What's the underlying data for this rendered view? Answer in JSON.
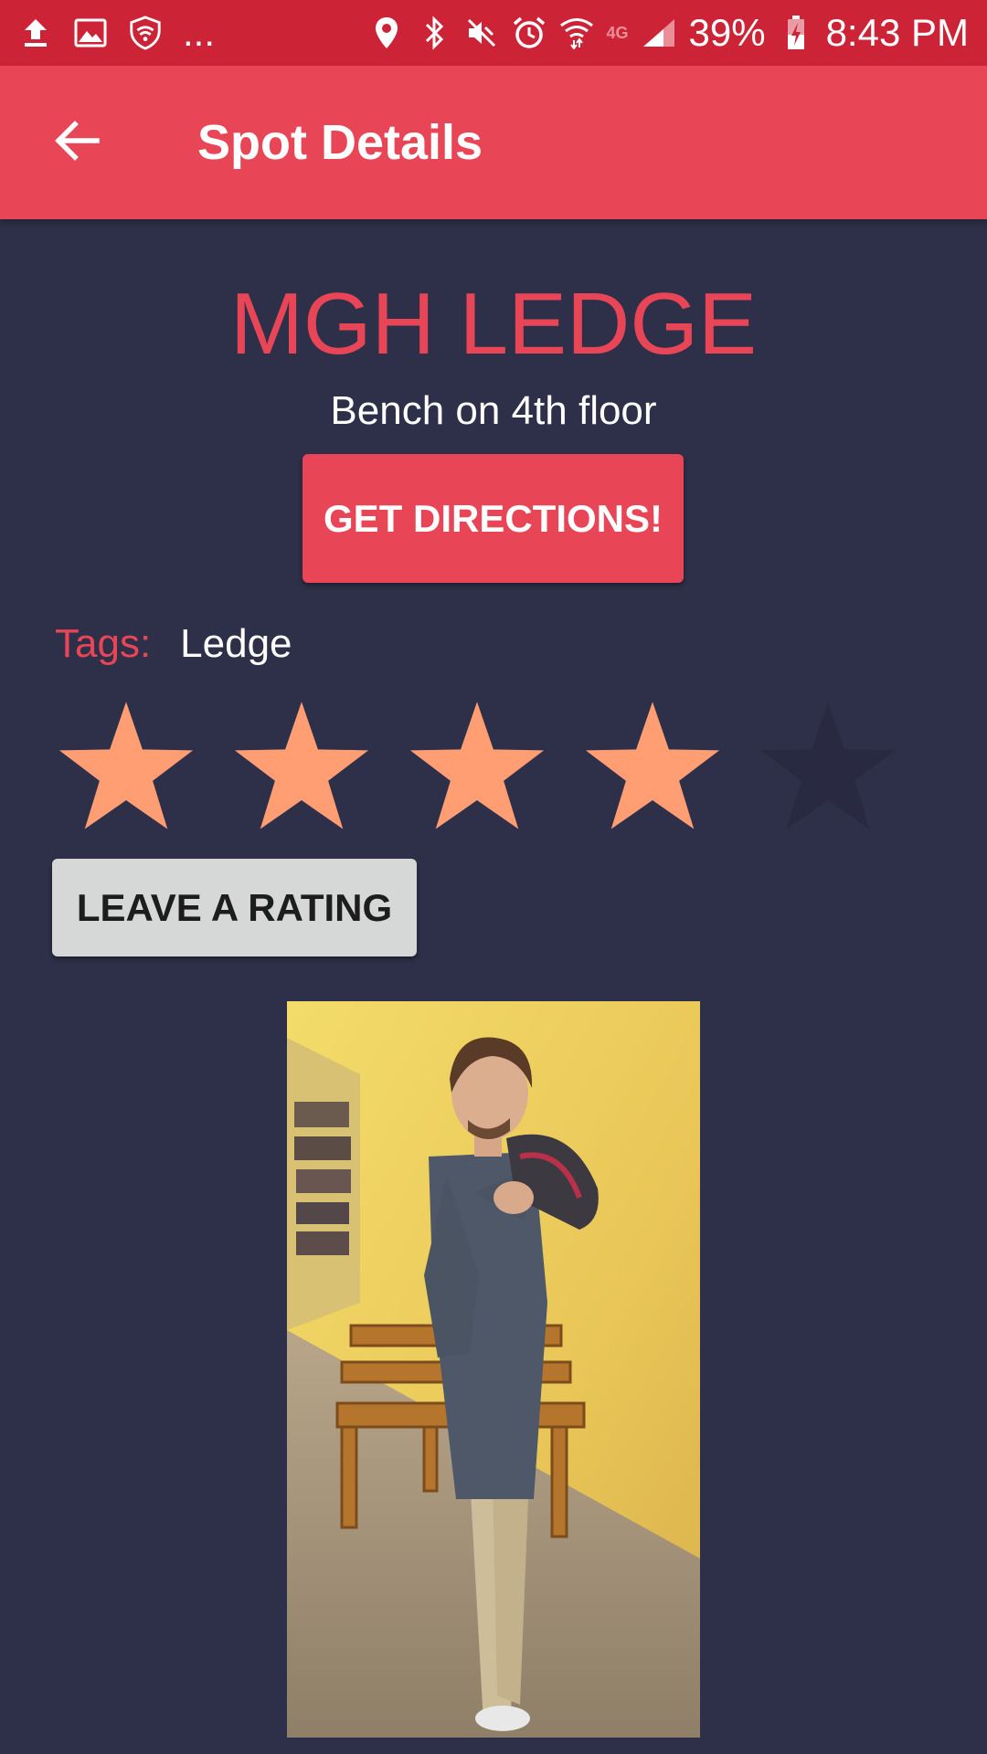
{
  "status_bar": {
    "left_icons": [
      "upload-icon",
      "image-icon",
      "shield-wifi-icon"
    ],
    "overflow_text": "...",
    "right_icons": [
      "location-pin-icon",
      "bluetooth-icon",
      "mute-icon",
      "alarm-icon",
      "wifi-icon",
      "lte-icon",
      "signal-icon"
    ],
    "network_label": "4G",
    "battery_percent": "39%",
    "time": "8:43 PM"
  },
  "app_bar": {
    "back_icon": "arrow-back-icon",
    "title": "Spot Details"
  },
  "spot": {
    "name": "MGH LEDGE",
    "description": "Bench on 4th floor",
    "directions_label": "GET DIRECTIONS!",
    "tags_label": "Tags:",
    "tags_value": "Ledge",
    "rating": 4,
    "rating_max": 5,
    "rate_label": "LEAVE A RATING",
    "photo_icon": "photo-person-bench"
  },
  "colors": {
    "status_bar": "#cd2337",
    "app_bar": "#e84657",
    "background": "#2e2f48",
    "accent": "#e84657",
    "star_filled": "#ff9d73",
    "star_empty": "#292a41",
    "rating_button": "#d6d7d7"
  }
}
